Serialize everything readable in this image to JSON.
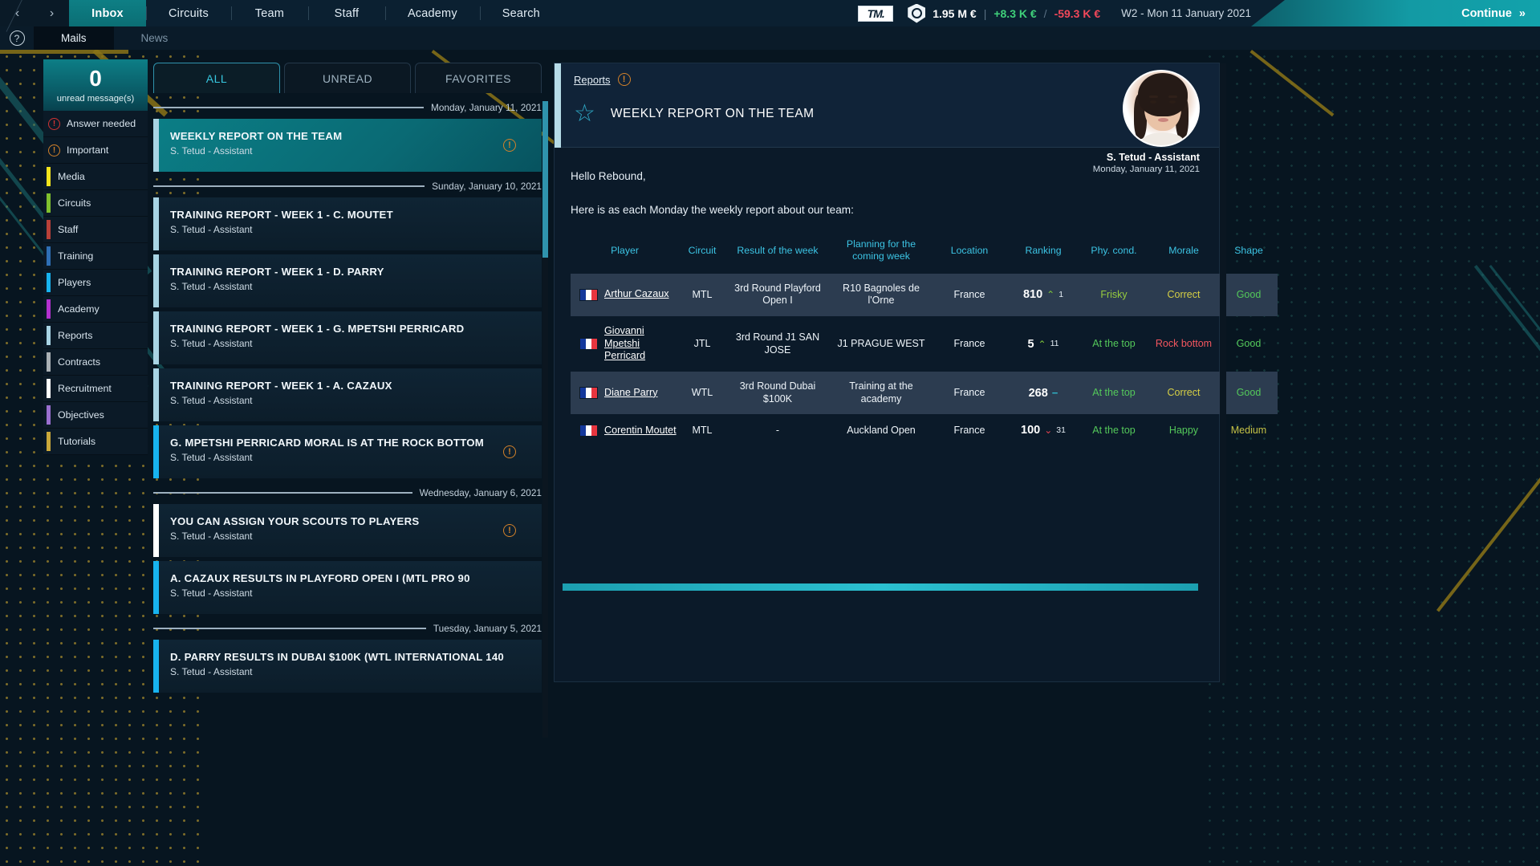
{
  "topnav": {
    "back_icon": "‹",
    "forward_icon": "›",
    "items": [
      {
        "label": "Inbox",
        "active": true
      },
      {
        "label": "Circuits",
        "active": false
      },
      {
        "label": "Team",
        "active": false
      },
      {
        "label": "Staff",
        "active": false
      },
      {
        "label": "Academy",
        "active": false
      },
      {
        "label": "Search",
        "active": false
      }
    ],
    "logo": "TM.",
    "money": "1.95 M €",
    "money_in": "+8.3 K €",
    "money_out": "-59.3 K €",
    "separator": "|",
    "slash": "/",
    "date": "W2 - Mon 11 January 2021",
    "continue_label": "Continue",
    "continue_icon": "»"
  },
  "subnav": {
    "help_icon": "?",
    "tabs": [
      {
        "label": "Mails",
        "active": true
      },
      {
        "label": "News",
        "active": false
      }
    ]
  },
  "sidebar": {
    "unread_count": "0",
    "unread_label": "unread message(s)",
    "items": [
      {
        "label": "Answer needed",
        "type": "icon",
        "color": "#d33333"
      },
      {
        "label": "Important",
        "type": "icon",
        "color": "#d2812a"
      },
      {
        "label": "Media",
        "type": "bar",
        "color": "#f2e41c"
      },
      {
        "label": "Circuits",
        "type": "bar",
        "color": "#7fc02e"
      },
      {
        "label": "Staff",
        "type": "bar",
        "color": "#b84038"
      },
      {
        "label": "Training",
        "type": "bar",
        "color": "#2e6fb5"
      },
      {
        "label": "Players",
        "type": "bar",
        "color": "#17b3ef"
      },
      {
        "label": "Academy",
        "type": "bar",
        "color": "#b331cf"
      },
      {
        "label": "Reports",
        "type": "bar",
        "color": "#a8d4e4"
      },
      {
        "label": "Contracts",
        "type": "bar",
        "color": "#aab0b4"
      },
      {
        "label": "Recruitment",
        "type": "bar",
        "color": "#ffffff"
      },
      {
        "label": "Objectives",
        "type": "bar",
        "color": "#9a6fd0"
      },
      {
        "label": "Tutorials",
        "type": "bar",
        "color": "#caa83a"
      }
    ]
  },
  "maillist": {
    "filters": [
      {
        "label": "ALL",
        "active": true
      },
      {
        "label": "UNREAD",
        "active": false
      },
      {
        "label": "FAVORITES",
        "active": false
      }
    ],
    "groups": [
      {
        "date": "Monday, January 11, 2021",
        "mails": [
          {
            "title": "WEEKLY REPORT ON THE TEAM",
            "from": "S. Tetud - Assistant",
            "bar": "#a8d4e4",
            "selected": true,
            "alert": "important"
          }
        ]
      },
      {
        "date": "Sunday, January 10, 2021",
        "mails": [
          {
            "title": "TRAINING REPORT - WEEK 1 - C. MOUTET",
            "from": "S. Tetud - Assistant",
            "bar": "#a8d4e4",
            "selected": false,
            "alert": null
          },
          {
            "title": "TRAINING REPORT - WEEK 1 - D. PARRY",
            "from": "S. Tetud - Assistant",
            "bar": "#a8d4e4",
            "selected": false,
            "alert": null
          },
          {
            "title": "TRAINING REPORT - WEEK 1 - G. MPETSHI PERRICARD",
            "from": "S. Tetud - Assistant",
            "bar": "#a8d4e4",
            "selected": false,
            "alert": null
          },
          {
            "title": "TRAINING REPORT - WEEK 1 - A. CAZAUX",
            "from": "S. Tetud - Assistant",
            "bar": "#a8d4e4",
            "selected": false,
            "alert": null
          },
          {
            "title": "G. MPETSHI PERRICARD MORAL IS AT THE ROCK BOTTOM",
            "from": "S. Tetud - Assistant",
            "bar": "#17b3ef",
            "selected": false,
            "alert": "important"
          }
        ]
      },
      {
        "date": "Wednesday, January 6, 2021",
        "mails": [
          {
            "title": "YOU CAN ASSIGN YOUR SCOUTS TO PLAYERS",
            "from": "S. Tetud - Assistant",
            "bar": "#ffffff",
            "selected": false,
            "alert": "important"
          },
          {
            "title": "A. CAZAUX RESULTS IN PLAYFORD OPEN I (MTL PRO 90",
            "from": "S. Tetud - Assistant",
            "bar": "#17b3ef",
            "selected": false,
            "alert": null
          }
        ]
      },
      {
        "date": "Tuesday, January 5, 2021",
        "mails": [
          {
            "title": "D. PARRY RESULTS IN DUBAI $100K (WTL INTERNATIONAL 140",
            "from": "S. Tetud - Assistant",
            "bar": "#17b3ef",
            "selected": false,
            "alert": null
          }
        ]
      }
    ]
  },
  "report": {
    "category": "Reports",
    "category_alert": "!",
    "star_icon": "☆",
    "title": "WEEKLY REPORT ON THE TEAM",
    "sender_name": "S. Tetud - Assistant",
    "sender_date": "Monday, January 11, 2021",
    "greeting": "Hello Rebound,",
    "intro": "Here is as each Monday the weekly report about our team:",
    "table": {
      "headers": [
        "Player",
        "Circuit",
        "Result of the week",
        "Planning for the coming week",
        "Location",
        "Ranking",
        "Phy. cond.",
        "Morale",
        "Shape"
      ],
      "rows": [
        {
          "player": "Arthur Cazaux",
          "flag": "France",
          "circuit": "MTL",
          "result": "3rd Round Playford Open I",
          "planning": "R10 Bagnoles de l'Orne",
          "location": "France",
          "ranking": "810",
          "rank_dir": "up",
          "rank_delta": "1",
          "phy_cond": "Frisky",
          "phy_color": "#97cc3e",
          "morale": "Correct",
          "morale_color": "#d6cf45",
          "shape": "Good",
          "shape_color": "#54c95a",
          "alt": true
        },
        {
          "player": "Giovanni Mpetshi Perricard",
          "flag": "France",
          "circuit": "JTL",
          "result": "3rd Round J1 SAN JOSE",
          "planning": "J1 PRAGUE WEST",
          "location": "France",
          "ranking": "5",
          "rank_dir": "up",
          "rank_delta": "11",
          "phy_cond": "At the top",
          "phy_color": "#54c95a",
          "morale": "Rock bottom",
          "morale_color": "#f4565f",
          "shape": "Good",
          "shape_color": "#54c95a",
          "alt": false
        },
        {
          "player": "Diane Parry",
          "flag": "France",
          "circuit": "WTL",
          "result": "3rd Round Dubai $100K",
          "planning": "Training at the academy",
          "location": "France",
          "ranking": "268",
          "rank_dir": "none",
          "rank_delta": "",
          "phy_cond": "At the top",
          "phy_color": "#54c95a",
          "morale": "Correct",
          "morale_color": "#d6cf45",
          "shape": "Good",
          "shape_color": "#54c95a",
          "alt": true
        },
        {
          "player": "Corentin Moutet",
          "flag": "France",
          "circuit": "MTL",
          "result": "-",
          "planning": "Auckland Open",
          "location": "France",
          "ranking": "100",
          "rank_dir": "down",
          "rank_delta": "31",
          "phy_cond": "At the top",
          "phy_color": "#54c95a",
          "morale": "Happy",
          "morale_color": "#54c95a",
          "shape": "Medium",
          "shape_color": "#c5c246",
          "alt": false
        }
      ]
    }
  }
}
